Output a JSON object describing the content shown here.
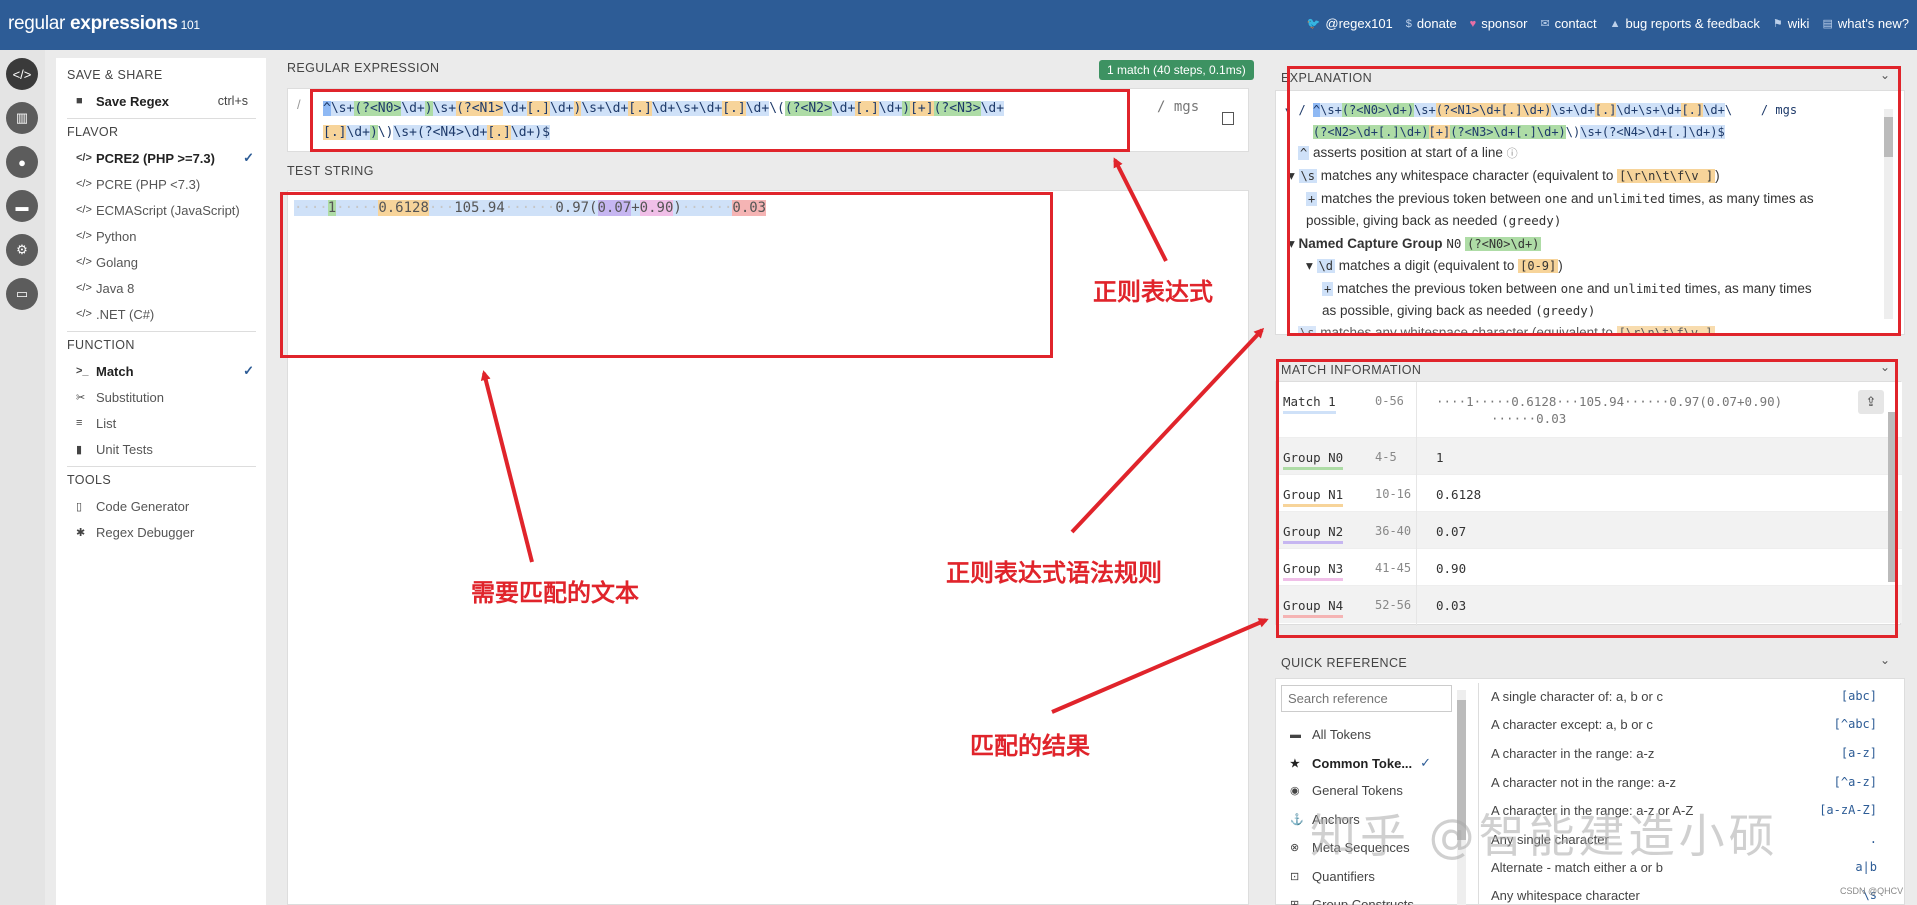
{
  "app": {
    "brand_left": "regular",
    "brand_right": "expressions",
    "version": "101"
  },
  "toplinks": [
    {
      "label": "@regex101",
      "icon": "twitter-icon"
    },
    {
      "label": "donate",
      "icon": "dollar-icon"
    },
    {
      "label": "sponsor",
      "icon": "heart-icon"
    },
    {
      "label": "contact",
      "icon": "mail-icon"
    },
    {
      "label": "bug reports & feedback",
      "icon": "warning-icon"
    },
    {
      "label": "wiki",
      "icon": "flag-icon"
    },
    {
      "label": "what's new?",
      "icon": "newspaper-icon"
    }
  ],
  "sidebar": {
    "save_title": "SAVE & SHARE",
    "save_label": "Save Regex",
    "save_shortcut": "ctrl+s",
    "flavor_title": "FLAVOR",
    "flavors": [
      "PCRE2 (PHP >=7.3)",
      "PCRE (PHP <7.3)",
      "ECMAScript (JavaScript)",
      "Python",
      "Golang",
      "Java 8",
      ".NET (C#)"
    ],
    "function_title": "FUNCTION",
    "functions": [
      "Match",
      "Substitution",
      "List",
      "Unit Tests"
    ],
    "tools_title": "TOOLS",
    "tools": [
      "Code Generator",
      "Regex Debugger"
    ]
  },
  "regex": {
    "title": "REGULAR EXPRESSION",
    "delimiter": "/",
    "flags": "/ mgs",
    "badge": "1 match (40 steps, 0.1ms)"
  },
  "test": {
    "title": "TEST STRING"
  },
  "explanation": {
    "title": "EXPLANATION",
    "lines": [
      "asserts position at start of a line",
      "matches any whitespace character (equivalent to",
      "matches the previous token between",
      "one",
      "and",
      "unlimited",
      "times, as many times as",
      "possible, giving back as needed",
      "(greedy)",
      "Named Capture Group",
      "N0",
      "matches a digit (equivalent to",
      "times, as many times",
      "as possible, giving back as needed",
      "matches any whitespace character (equivalent to"
    ],
    "tokens": {
      "ws_set": "[\\r\\n\\t\\f\\v ]",
      "digit_set": "[0-9]",
      "g0": "(?<N0>\\d+)"
    }
  },
  "match_info": {
    "title": "MATCH INFORMATION",
    "rows": [
      {
        "name": "Match 1",
        "range": "0-56",
        "value": "····1·····0.6128···105.94······0.97(0.07+0.90)",
        "value2": "······0.03",
        "color": "#cfe1f8"
      },
      {
        "name": "Group N0",
        "range": "4-5",
        "value": "1",
        "color": "#aedca6"
      },
      {
        "name": "Group N1",
        "range": "10-16",
        "value": "0.6128",
        "color": "#f7d49a"
      },
      {
        "name": "Group N2",
        "range": "36-40",
        "value": "0.07",
        "color": "#c6b6f1"
      },
      {
        "name": "Group N3",
        "range": "41-45",
        "value": "0.90",
        "color": "#f0bfe8"
      },
      {
        "name": "Group N4",
        "range": "52-56",
        "value": "0.03",
        "color": "#f5b4b4"
      }
    ]
  },
  "quick_ref": {
    "title": "QUICK REFERENCE",
    "search_placeholder": "Search reference",
    "categories": [
      "All Tokens",
      "Common Toke...",
      "General Tokens",
      "Anchors",
      "Meta Sequences",
      "Quantifiers",
      "Group Constructs"
    ],
    "items": [
      {
        "desc": "A single character of: a, b or c",
        "tok": "[abc]"
      },
      {
        "desc": "A character except: a, b or c",
        "tok": "[^abc]"
      },
      {
        "desc": "A character in the range: a-z",
        "tok": "[a-z]"
      },
      {
        "desc": "A character not in the range: a-z",
        "tok": "[^a-z]"
      },
      {
        "desc": "A character in the range: a-z or A-Z",
        "tok": "[a-zA-Z]"
      },
      {
        "desc": "Any single character",
        "tok": "."
      },
      {
        "desc": "Alternate - match either a or b",
        "tok": "a|b"
      },
      {
        "desc": "Any whitespace character",
        "tok": "\\s"
      }
    ]
  },
  "annotations": {
    "regex_label": "正则表达式",
    "text_label": "需要匹配的文本",
    "rules_label": "正则表达式语法规则",
    "result_label": "匹配的结果",
    "watermark": "知乎 @智能建造小硕",
    "credit": "CSDN @QHCV"
  },
  "colors": {
    "header": "#2d5c96",
    "annotation": "#e0242b",
    "badge": "#3d9262"
  }
}
